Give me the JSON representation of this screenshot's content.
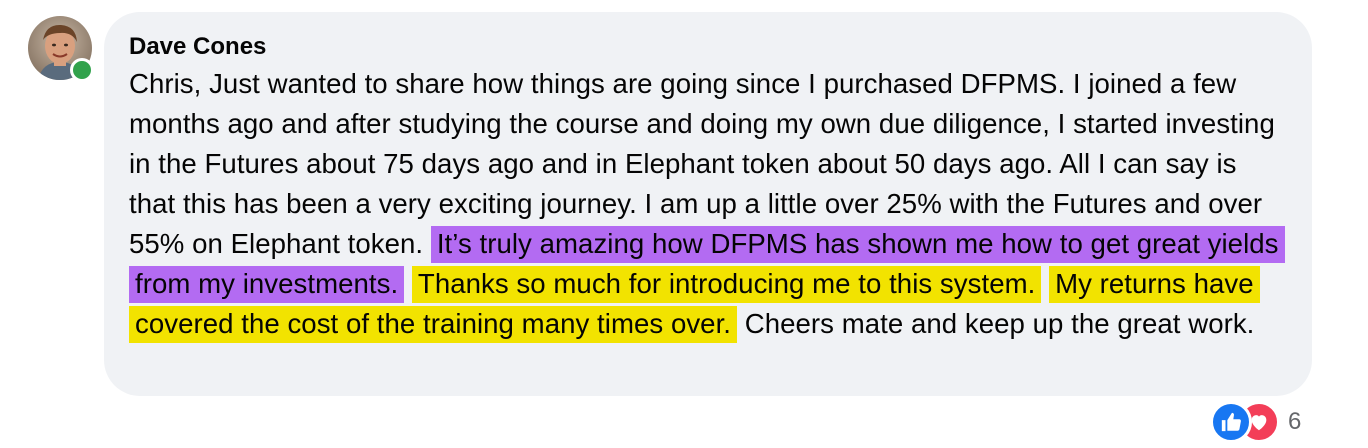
{
  "comment": {
    "author": "Dave Cones",
    "segments": [
      "Chris, Just wanted to share how things are going since I purchased DFPMS. I joined a few months ago and after studying the course and doing my own due diligence, I started investing in the Futures about 75 days ago and in Elephant token about 50 days ago. All I can say is that this has been a very exciting journey. I am up a little over 25% with the Futures and over 55% on Elephant token. ",
      "It’s truly amazing how DFPMS has shown me how to get great yields from my investments.",
      " ",
      "Thanks so much for introducing me to this system.",
      " ",
      "My returns have covered the cost of the training many times over.",
      " Cheers mate and keep up the great work."
    ],
    "highlight_colors": {
      "purple": "#b36bf2",
      "yellow": "#f2e300"
    },
    "online_status_color": "#31a24c",
    "bubble_color": "#f0f2f5"
  },
  "reactions": {
    "icons": [
      "like-icon",
      "love-icon"
    ],
    "count": "6"
  }
}
